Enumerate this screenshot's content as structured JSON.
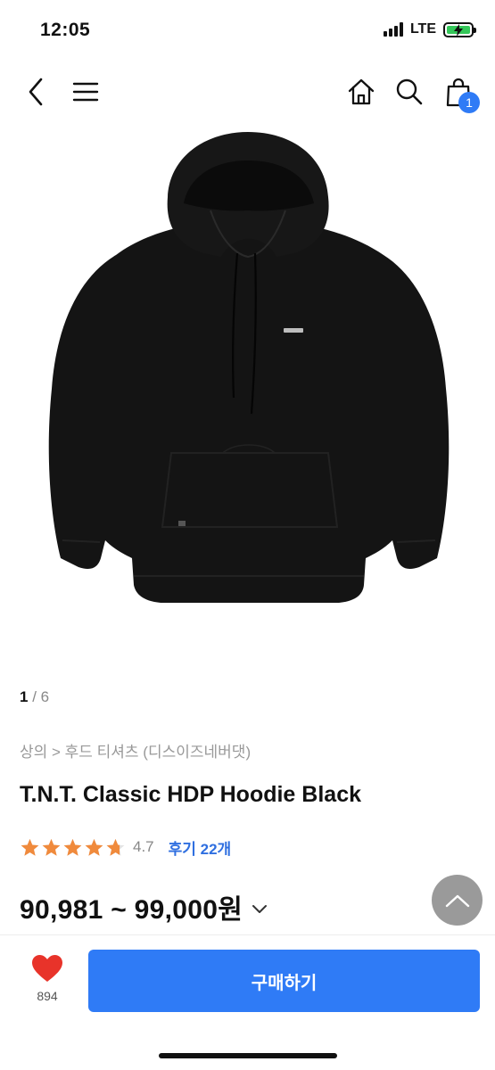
{
  "status_bar": {
    "time": "12:05",
    "network": "LTE",
    "battery_charging": true
  },
  "nav": {
    "back_icon": "chevron-left-icon",
    "menu_icon": "hamburger-menu-icon",
    "home_icon": "home-icon",
    "search_icon": "search-icon",
    "cart_icon": "shopping-bag-icon",
    "cart_count": "1"
  },
  "product": {
    "image_alt": "black hoodie",
    "image_index": "1",
    "image_separator": " / ",
    "image_total": "6",
    "breadcrumb": "상의 > 후드 티셔츠 (디스이즈네버댓)",
    "title": "T.N.T. Classic HDP Hoodie Black",
    "rating": 4.7,
    "rating_text": "4.7",
    "reviews_label": "후기 22개",
    "price_range": "90,981 ~ 99,000원"
  },
  "actions": {
    "like_count": "894",
    "buy_label": "구매하기",
    "scroll_top_icon": "chevron-up-icon"
  },
  "colors": {
    "accent": "#2f7bf6",
    "star": "#f08a3c",
    "like_heart": "#e8332a",
    "link": "#2f6fe0"
  }
}
